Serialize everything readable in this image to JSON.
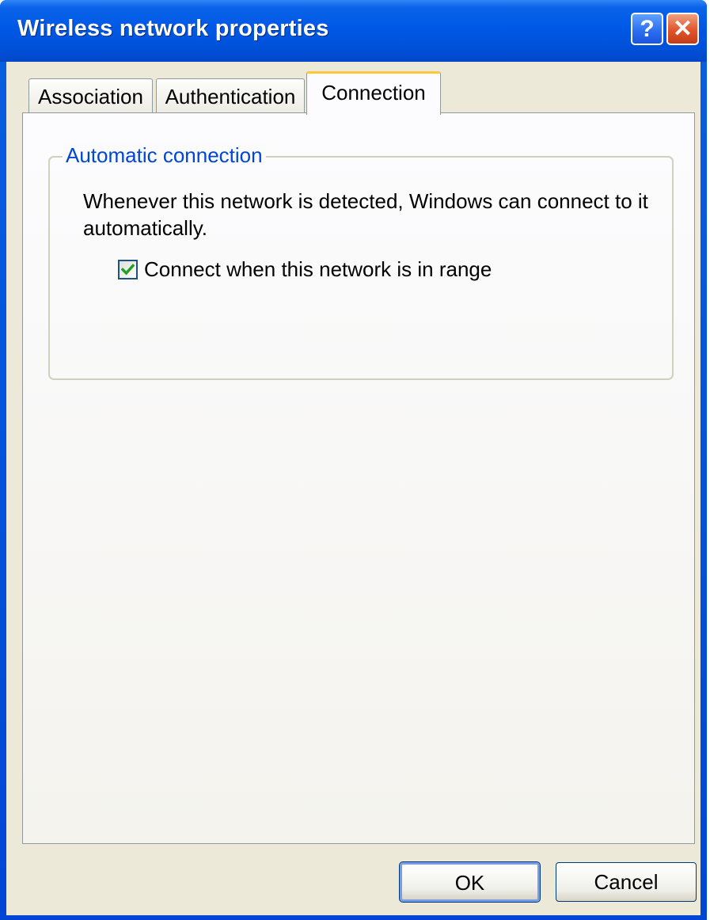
{
  "window": {
    "title": "Wireless network properties",
    "help_label": "?",
    "close_label": "✕"
  },
  "tabs": [
    {
      "label": "Association",
      "active": false
    },
    {
      "label": "Authentication",
      "active": false
    },
    {
      "label": "Connection",
      "active": true
    }
  ],
  "connection": {
    "group_title": "Automatic connection",
    "description": "Whenever this network is detected, Windows can connect to it automatically.",
    "checkbox": {
      "label": "Connect when this network is in range",
      "checked": true
    }
  },
  "footer": {
    "ok_label": "OK",
    "cancel_label": "Cancel"
  },
  "colors": {
    "titlebar": "#0058e6",
    "group_title": "#0046d5",
    "check_mark": "#21a121",
    "active_tab_accent": "#ffc83c"
  }
}
